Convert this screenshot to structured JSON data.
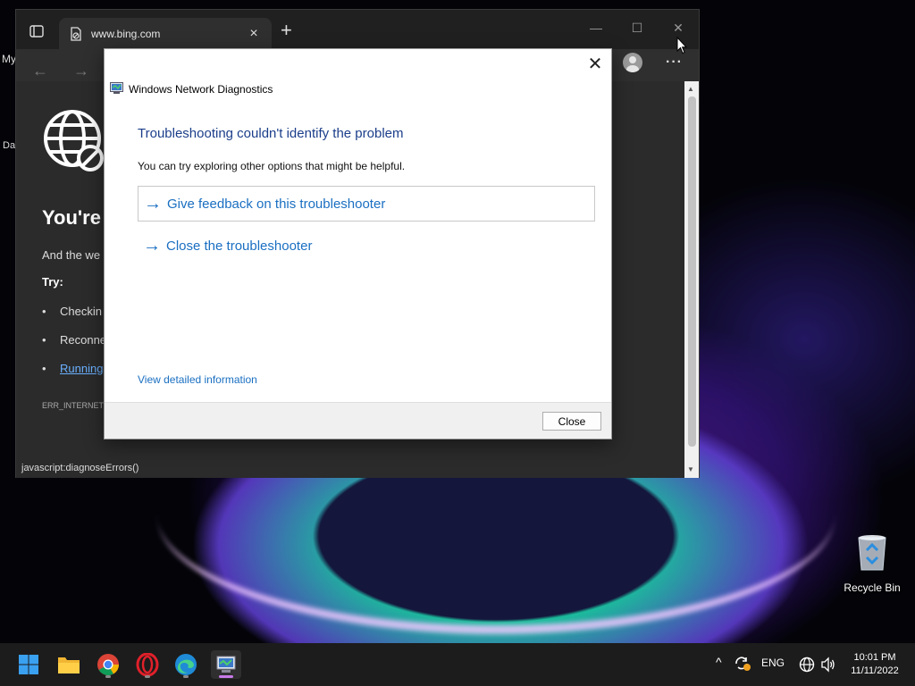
{
  "desktop": {
    "left_labels": [
      "My",
      "Da"
    ],
    "recycle_bin_label": "Recycle Bin"
  },
  "browser": {
    "tab_title": "www.bing.com",
    "tab_close": "×",
    "new_tab": "+",
    "window_controls": {
      "minimize": "—",
      "maximize": "☐",
      "close": "✕"
    },
    "nav": {
      "back": "←",
      "forward": "→"
    },
    "more": "···",
    "page": {
      "title": "You're",
      "text": "And the we",
      "try_label": "Try:",
      "items": [
        "Checkin",
        "Reconne",
        "Running"
      ],
      "error_code": "ERR_INTERNET"
    },
    "status_url": "javascript:diagnoseErrors()"
  },
  "dialog": {
    "title": "Windows Network Diagnostics",
    "close_glyph": "✕",
    "heading": "Troubleshooting couldn't identify the problem",
    "subtext": "You can try exploring other options that might be helpful.",
    "options": [
      {
        "arrow": "→",
        "label": "Give feedback on this troubleshooter"
      },
      {
        "arrow": "→",
        "label": "Close the troubleshooter"
      }
    ],
    "detail_link": "View detailed information",
    "close_button": "Close"
  },
  "taskbar": {
    "apps": [
      "start-icon",
      "file-explorer-icon",
      "chrome-icon",
      "opera-icon",
      "edge-icon",
      "network-diagnostics-icon"
    ],
    "tray": {
      "chevron": "^",
      "language": "ENG"
    },
    "clock": {
      "time": "10:01 PM",
      "date": "11/11/2022"
    }
  },
  "colors": {
    "link_blue": "#1a6fc2",
    "heading_blue": "#1b3e8a",
    "active_indicator": "#c87ae8"
  }
}
